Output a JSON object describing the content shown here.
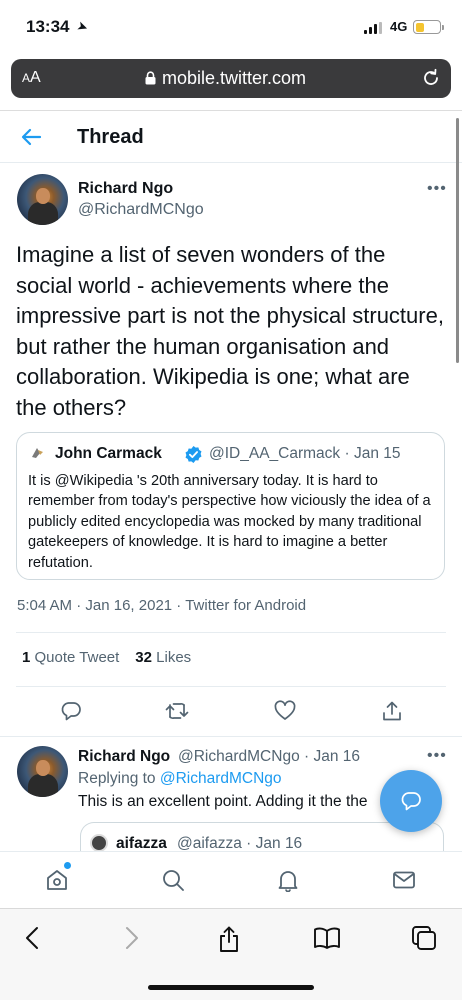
{
  "status_bar": {
    "time": "13:34",
    "location_icon": "location-arrow-icon",
    "network": "4G"
  },
  "url_bar": {
    "text_size": "AA",
    "url": "mobile.twitter.com"
  },
  "header": {
    "title": "Thread"
  },
  "tweet": {
    "author_name": "Richard Ngo",
    "author_handle": "@RichardMCNgo",
    "text": "Imagine a list of seven wonders of the social world - achievements where the impressive part is not the physical structure, but rather the human organisation and collaboration. Wikipedia is one; what are the others?",
    "quote": {
      "name": "John Carmack",
      "handle": "@ID_AA_Carmack",
      "date": "Jan 15",
      "text": "It is @Wikipedia 's 20th anniversary today. It is hard to remember from today's perspective how viciously the idea of a publicly edited encyclopedia was mocked by many traditional gatekeepers of knowledge. It is hard to imagine a better refutation."
    },
    "time": "5:04 AM",
    "date": "Jan 16, 2021",
    "source": "Twitter for Android",
    "quote_tweets_count": "1",
    "quote_tweets_label": "Quote Tweet",
    "likes_count": "32",
    "likes_label": "Likes"
  },
  "reply": {
    "author_name": "Richard Ngo",
    "author_handle": "@RichardMCNgo",
    "date": "Jan 16",
    "replying_label": "Replying to",
    "replying_to": "@RichardMCNgo",
    "text": "This is an excellent point. Adding it the the",
    "quote": {
      "name": "aifazza",
      "handle": "@aifazza",
      "date": "Jan 16"
    }
  },
  "colors": {
    "accent": "#1d9bf0",
    "fab": "#4da3ea",
    "url_bar_bg": "#3a3a3c",
    "secondary_text": "#536471"
  }
}
